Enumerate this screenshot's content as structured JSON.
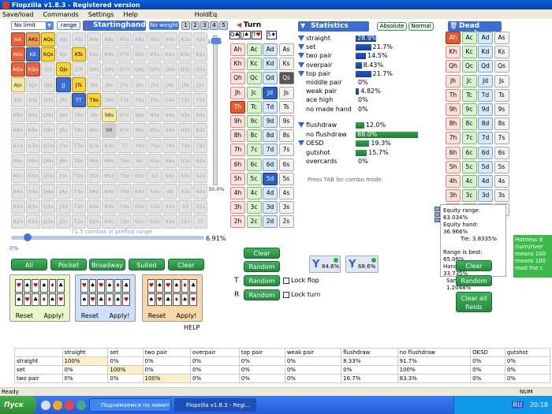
{
  "window": {
    "title": "Flopzilla v1.8.3 - Registered version"
  },
  "menu": [
    "Save/load",
    "Commands",
    "Settings",
    "Help",
    "HoldEq"
  ],
  "toolbar": {
    "limit_select": "No limit",
    "range_btn": "range",
    "starting_hand": "Startinghand",
    "no_weight": "No weight",
    "turn": "Turn",
    "statistics": "Statistics",
    "absolute": "Absolute",
    "normal": "Normal",
    "dead_cards": "Dead cards",
    "board": [
      "Q♣",
      "J♠",
      "T♥",
      "5♦"
    ],
    "tabs": [
      "1",
      "2",
      "3",
      "4",
      "5"
    ]
  },
  "hand_grid": [
    [
      "AA",
      "AKs",
      "AQs",
      "AJs",
      "ATs",
      "A9s",
      "A8s",
      "A7s",
      "A6s",
      "A5s",
      "A4s",
      "A3s",
      "A2s"
    ],
    [
      "AKo",
      "KK",
      "KQs",
      "KJs",
      "KTs",
      "K9s",
      "K8s",
      "K7s",
      "K6s",
      "K5s",
      "K4s",
      "K3s",
      "K2s"
    ],
    [
      "AQo",
      "KQo",
      "QQ",
      "QJs",
      "QTs",
      "Q9s",
      "Q8s",
      "Q7s",
      "Q6s",
      "Q5s",
      "Q4s",
      "Q3s",
      "Q2s"
    ],
    [
      "AJo",
      "KJo",
      "QJo",
      "JJ",
      "JTs",
      "J9s",
      "J8s",
      "J7s",
      "J6s",
      "J5s",
      "J4s",
      "J3s",
      "J2s"
    ],
    [
      "ATo",
      "KTo",
      "QTo",
      "JTo",
      "TT",
      "T9s",
      "T8s",
      "T7s",
      "T6s",
      "T5s",
      "T4s",
      "T3s",
      "T2s"
    ],
    [
      "A9o",
      "K9o",
      "Q9o",
      "J9o",
      "T9o",
      "99",
      "98s",
      "97s",
      "96s",
      "95s",
      "94s",
      "93s",
      "92s"
    ],
    [
      "A8o",
      "K8o",
      "Q8o",
      "J8o",
      "T8o",
      "98o",
      "88",
      "87s",
      "86s",
      "85s",
      "84s",
      "83s",
      "82s"
    ],
    [
      "A7o",
      "K7o",
      "Q7o",
      "J7o",
      "T7o",
      "97o",
      "87o",
      "77",
      "76s",
      "75s",
      "74s",
      "73s",
      "72s"
    ],
    [
      "A6o",
      "K6o",
      "Q6o",
      "J6o",
      "T6o",
      "96o",
      "86o",
      "76o",
      "66",
      "65s",
      "64s",
      "63s",
      "62s"
    ],
    [
      "A5o",
      "K5o",
      "Q5o",
      "J5o",
      "T5o",
      "95o",
      "85o",
      "75o",
      "65o",
      "55",
      "54s",
      "53s",
      "52s"
    ],
    [
      "A4o",
      "K4o",
      "Q4o",
      "J4o",
      "T4o",
      "94o",
      "84o",
      "74o",
      "64o",
      "54o",
      "44",
      "43s",
      "42s"
    ],
    [
      "A3o",
      "K3o",
      "Q3o",
      "J3o",
      "T3o",
      "93o",
      "83o",
      "73o",
      "63o",
      "53o",
      "43o",
      "33",
      "32s"
    ],
    [
      "A2o",
      "K2o",
      "Q2o",
      "J2o",
      "T2o",
      "92o",
      "82o",
      "72o",
      "62o",
      "52o",
      "42o",
      "32o",
      "22"
    ]
  ],
  "range_info": {
    "combos": "71.5 combos in preflop range",
    "pct": "6.91%",
    "slider_fraction": 0.0691,
    "low": "0%",
    "vtop": "100%",
    "vbottom": "30.0%"
  },
  "range_buttons": [
    "All",
    "Pocket",
    "Broadway",
    "Suited",
    "Clear"
  ],
  "presets": [
    {
      "reset": "Reset",
      "apply": "Apply!"
    },
    {
      "reset": "Reset",
      "apply": "Apply!"
    },
    {
      "reset": "Reset",
      "apply": "Apply!"
    }
  ],
  "help": "HELP",
  "turn_cards": [
    [
      "Ah",
      "Ac",
      "Ad",
      "As"
    ],
    [
      "Kh",
      "Kc",
      "Kd",
      "Ks"
    ],
    [
      "Qh",
      "Qc",
      "Qd",
      "Qs"
    ],
    [
      "Jh",
      "Jc",
      "Jd",
      "Js"
    ],
    [
      "Th",
      "Tc",
      "Td",
      "Ts"
    ],
    [
      "9h",
      "9c",
      "9d",
      "9s"
    ],
    [
      "8h",
      "8c",
      "8d",
      "8s"
    ],
    [
      "7h",
      "7c",
      "7d",
      "7s"
    ],
    [
      "6h",
      "6c",
      "6d",
      "6s"
    ],
    [
      "5h",
      "5c",
      "5d",
      "5s"
    ],
    [
      "4h",
      "4c",
      "4d",
      "4s"
    ],
    [
      "3h",
      "3c",
      "3d",
      "3s"
    ],
    [
      "2h",
      "2c",
      "2d",
      "2s"
    ]
  ],
  "turn_buttons": {
    "clear": "Clear",
    "random": "Random",
    "random2": "Random",
    "random3": "Random",
    "lock_flop": "Lock flop",
    "lock_turn": "Lock turn",
    "filter1": "84.6%",
    "filter2": "68.6%"
  },
  "stats": [
    {
      "label": "straight",
      "value": "28.9%",
      "pct": 28.9
    },
    {
      "label": "set",
      "value": "21.7%",
      "pct": 21.7
    },
    {
      "label": "two pair",
      "value": "14.5%",
      "pct": 14.5
    },
    {
      "label": "overpair",
      "value": "8.43%",
      "pct": 8.43
    },
    {
      "label": "top pair",
      "value": "21.7%",
      "pct": 21.7
    },
    {
      "label": "middle pair",
      "value": "0%",
      "pct": 0
    },
    {
      "label": "weak pair",
      "value": "4.82%",
      "pct": 4.82
    },
    {
      "label": "ace high",
      "value": "0%",
      "pct": 0
    },
    {
      "label": "no made hand",
      "value": "0%",
      "pct": 0
    }
  ],
  "draws": [
    {
      "label": "flushdraw",
      "value": "12.0%",
      "pct": 12.0
    },
    {
      "label": "no flushdraw",
      "value": "88.0%",
      "pct": 88.0
    },
    {
      "label": "OESD",
      "value": "19.3%",
      "pct": 19.3
    },
    {
      "label": "gutshot",
      "value": "15.7%",
      "pct": 15.7
    },
    {
      "label": "overcards",
      "value": "0%",
      "pct": 0
    }
  ],
  "hint": "Press TAB for combo mode",
  "dead_cards": [
    [
      "Ah",
      "Ac",
      "Ad",
      "As"
    ],
    [
      "Kh",
      "Kc",
      "Kd",
      "Ks"
    ],
    [
      "Qh",
      "Qc",
      "Qd",
      "Qs"
    ],
    [
      "Jh",
      "Jc",
      "Jd",
      "Js"
    ],
    [
      "Th",
      "Tc",
      "Td",
      "Ts"
    ],
    [
      "9h",
      "9c",
      "9d",
      "9s"
    ],
    [
      "8h",
      "8c",
      "8d",
      "8s"
    ],
    [
      "7h",
      "7c",
      "7d",
      "7s"
    ],
    [
      "6h",
      "6c",
      "6d",
      "6s"
    ],
    [
      "5h",
      "5c",
      "5d",
      "5s"
    ],
    [
      "4h",
      "4c",
      "4d",
      "4s"
    ],
    [
      "3h",
      "3c",
      "3d",
      "3s"
    ],
    [
      "2h",
      "2c",
      "2d",
      "2s"
    ]
  ],
  "equity": {
    "l1": "Equity range: 63.034%",
    "l2": "Equity hand: 36.966%",
    "l3": "Tie: 3.8335%",
    "l4": "Range is best: 65.06%",
    "l5": "Hand is best: 33.735%",
    "l6": "Same hand: 1.2048%"
  },
  "dead_buttons": {
    "clear": "Clear",
    "random": "Random",
    "clear_all": "Clear all fields"
  },
  "hotness": "Hotness d (turn/river means 100 means 100 read the c",
  "table": {
    "headers": [
      "",
      "straight",
      "set",
      "two pair",
      "overpair",
      "top pair",
      "weak pair",
      "flushdraw",
      "no flushdraw",
      "OESD",
      "gutshot"
    ],
    "rows": [
      [
        "straight",
        "100%",
        "0%",
        "0%",
        "0%",
        "0%",
        "0%",
        "8.33%",
        "91.7%",
        "0%",
        "0%"
      ],
      [
        "set",
        "0%",
        "100%",
        "0%",
        "0%",
        "0%",
        "0%",
        "0%",
        "100%",
        "0%",
        "0%"
      ],
      [
        "two pair",
        "0%",
        "0%",
        "100%",
        "0%",
        "0%",
        "0%",
        "16.7%",
        "83.3%",
        "0%",
        "0%"
      ]
    ]
  },
  "status": {
    "left": "Ready",
    "num": "NUM"
  },
  "taskbar": {
    "start": "Пуск",
    "task1": "Поднимаемся по лимит...",
    "task2": "Flopzilla v1.8.3 - Regi...",
    "lang": "RU",
    "time": "20:18"
  }
}
